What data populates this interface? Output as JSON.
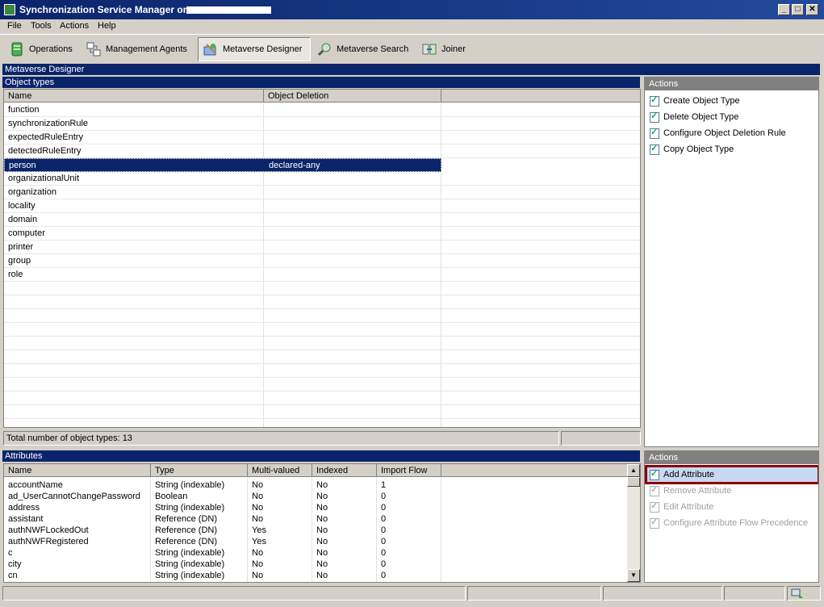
{
  "window": {
    "title": "Synchronization Service Manager on",
    "minimize": "_",
    "maximize": "□",
    "close": "✕"
  },
  "menu": [
    "File",
    "Tools",
    "Actions",
    "Help"
  ],
  "toolbar": [
    {
      "label": "Operations",
      "icon": "operations-icon"
    },
    {
      "label": "Management Agents",
      "icon": "management-agents-icon"
    },
    {
      "label": "Metaverse Designer",
      "icon": "metaverse-designer-icon",
      "active": true
    },
    {
      "label": "Metaverse Search",
      "icon": "metaverse-search-icon"
    },
    {
      "label": "Joiner",
      "icon": "joiner-icon"
    }
  ],
  "designer": {
    "section_title": "Metaverse Designer",
    "object_types_title": "Object types",
    "columns": [
      "Name",
      "Object Deletion"
    ],
    "rows": [
      {
        "name": "function",
        "deletion": ""
      },
      {
        "name": "synchronizationRule",
        "deletion": ""
      },
      {
        "name": "expectedRuleEntry",
        "deletion": ""
      },
      {
        "name": "detectedRuleEntry",
        "deletion": ""
      },
      {
        "name": "person",
        "deletion": "declared-any",
        "selected": true
      },
      {
        "name": "organizationalUnit",
        "deletion": ""
      },
      {
        "name": "organization",
        "deletion": ""
      },
      {
        "name": "locality",
        "deletion": ""
      },
      {
        "name": "domain",
        "deletion": ""
      },
      {
        "name": "computer",
        "deletion": ""
      },
      {
        "name": "printer",
        "deletion": ""
      },
      {
        "name": "group",
        "deletion": ""
      },
      {
        "name": "role",
        "deletion": ""
      }
    ],
    "status": "Total number of object types: 13"
  },
  "object_actions": {
    "title": "Actions",
    "items": [
      {
        "label": "Create Object Type",
        "enabled": true
      },
      {
        "label": "Delete Object Type",
        "enabled": true
      },
      {
        "label": "Configure Object Deletion Rule",
        "enabled": true
      },
      {
        "label": "Copy Object Type",
        "enabled": true
      }
    ]
  },
  "attributes": {
    "title": "Attributes",
    "columns": [
      "Name",
      "Type",
      "Multi-valued",
      "Indexed",
      "Import Flow"
    ],
    "rows": [
      [
        "accountName",
        "String (indexable)",
        "No",
        "No",
        "1"
      ],
      [
        "ad_UserCannotChangePassword",
        "Boolean",
        "No",
        "No",
        "0"
      ],
      [
        "address",
        "String (indexable)",
        "No",
        "No",
        "0"
      ],
      [
        "assistant",
        "Reference (DN)",
        "No",
        "No",
        "0"
      ],
      [
        "authNWFLockedOut",
        "Reference (DN)",
        "Yes",
        "No",
        "0"
      ],
      [
        "authNWFRegistered",
        "Reference (DN)",
        "Yes",
        "No",
        "0"
      ],
      [
        "c",
        "String (indexable)",
        "No",
        "No",
        "0"
      ],
      [
        "city",
        "String (indexable)",
        "No",
        "No",
        "0"
      ],
      [
        "cn",
        "String (indexable)",
        "No",
        "No",
        "0"
      ]
    ]
  },
  "attribute_actions": {
    "title": "Actions",
    "items": [
      {
        "label": "Add Attribute",
        "enabled": true,
        "highlighted": true
      },
      {
        "label": "Remove Attribute",
        "enabled": false
      },
      {
        "label": "Edit Attribute",
        "enabled": false
      },
      {
        "label": "Configure Attribute Flow Precedence",
        "enabled": false
      }
    ]
  },
  "colors": {
    "title_bar": "#0a246a",
    "selection": "#0a246a",
    "highlight_border": "#8b0000"
  }
}
